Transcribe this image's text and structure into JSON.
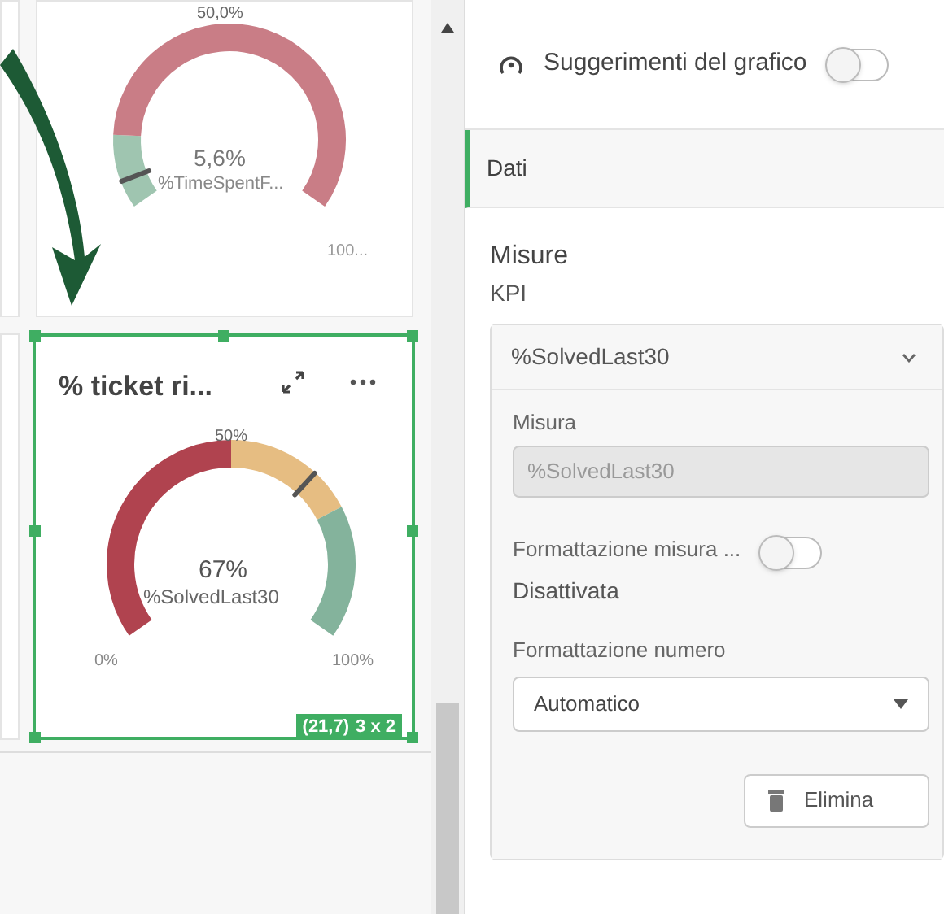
{
  "gauges": [
    {
      "value": "5,6%",
      "measure": "%TimeSpentF...",
      "mid_label": "50,0%",
      "max_label": "100...",
      "bands": [
        {
          "color": "#9fc5b0"
        },
        {
          "color": "#c97d86"
        }
      ],
      "selected": false
    },
    {
      "title": "% ticket ri...",
      "value": "67%",
      "measure": "%SolvedLast30",
      "min_label": "0%",
      "mid_label": "50%",
      "max_label": "100%",
      "bands": [
        {
          "color": "#b0434f"
        },
        {
          "color": "#e6bd82"
        },
        {
          "color": "#84b39c"
        }
      ],
      "selected": true,
      "position_badge": "(21,7)",
      "size_badge": "3 x 2"
    }
  ],
  "panel": {
    "chart_suggestions": {
      "label": "Suggerimenti del grafico",
      "on": false
    },
    "tabs": [
      {
        "label": "Dati",
        "selected": true
      }
    ],
    "section_title": "Misure",
    "subsection_title": "KPI",
    "measure": {
      "header": "%SolvedLast30",
      "expanded": true,
      "field_label": "Misura",
      "field_value": "%SolvedLast30",
      "format_toggle": {
        "label": "Formattazione misura ...",
        "state": "Disattivata",
        "on": false
      },
      "number_format_label": "Formattazione numero",
      "number_format_value": "Automatico",
      "delete_button": "Elimina"
    }
  }
}
